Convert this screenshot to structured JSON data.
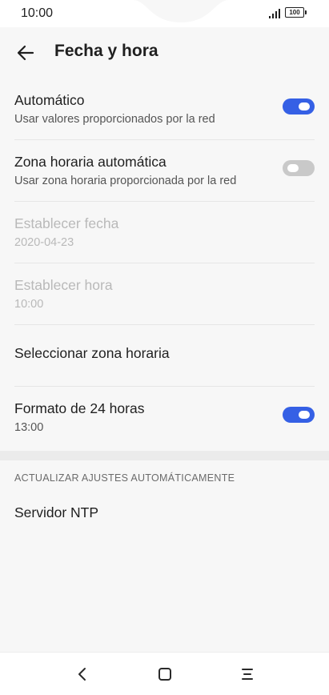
{
  "status_bar": {
    "time": "10:00",
    "battery": "100",
    "icons": [
      "signal-icon",
      "battery-icon"
    ]
  },
  "header": {
    "title": "Fecha y hora",
    "back_icon": "arrow-left-icon"
  },
  "settings": [
    {
      "title": "Automático",
      "subtitle": "Usar valores proporcionados por la red",
      "toggle": true,
      "enabled": true
    },
    {
      "title": "Zona horaria automática",
      "subtitle": "Usar zona horaria proporcionada por la red",
      "toggle": false,
      "enabled": true
    },
    {
      "title": "Establecer fecha",
      "subtitle": "2020-04-23",
      "enabled": false
    },
    {
      "title": "Establecer hora",
      "subtitle": "10:00",
      "enabled": false
    },
    {
      "title": "Seleccionar zona horaria",
      "subtitle": "",
      "enabled": true
    },
    {
      "title": "Formato de 24 horas",
      "subtitle": "13:00",
      "toggle": true,
      "enabled": true
    }
  ],
  "section": {
    "header": "ACTUALIZAR AJUSTES AUTOMÁTICAMENTE",
    "items": [
      {
        "title": "Servidor NTP"
      }
    ]
  },
  "nav_bar": {
    "icons": [
      "back-icon",
      "home-icon",
      "menu-icon"
    ]
  },
  "colors": {
    "accent": "#3560e5",
    "toggle_off": "#c9c9c9",
    "disabled_text": "#b9b9b9"
  }
}
